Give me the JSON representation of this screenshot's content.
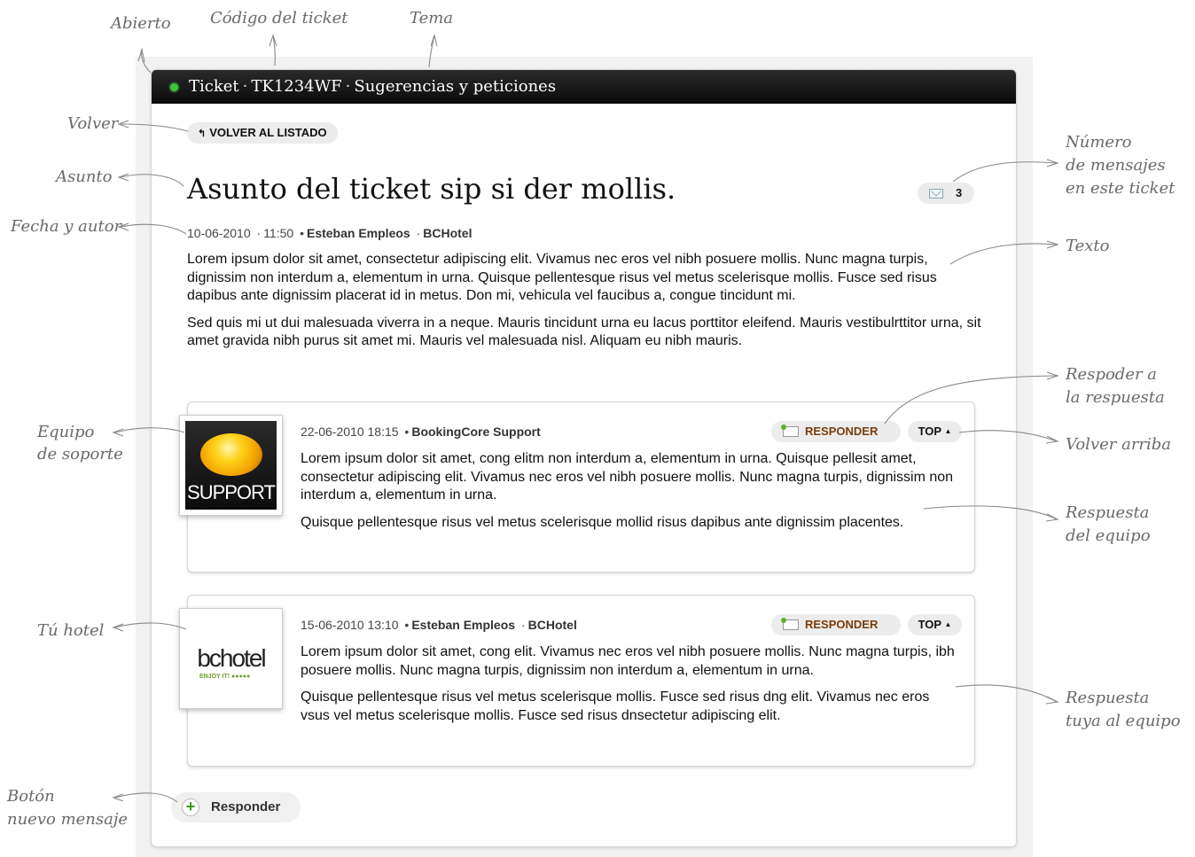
{
  "ticket": {
    "header_label": "Ticket",
    "code": "TK1234WF",
    "topic": "Sugerencias y peticiones",
    "status_color": "#3cc43c",
    "back_button": "VOLVER AL LISTADO",
    "subject": "Asunto del ticket sip si der mollis.",
    "message_count": "3",
    "date": "10-06-2010",
    "time": "11:50",
    "author": "Esteban Empleos",
    "company": "BCHotel",
    "paragraphs": [
      "Lorem ipsum dolor sit amet, consectetur adipiscing elit. Vivamus nec eros vel nibh posuere mollis. Nunc magna turpis, dignissim non interdum a, elementum in urna. Quisque pellentesque risus vel metus scelerisque mollis. Fusce sed risus dapibus ante dignissim placerat id in metus. Don mi, vehicula vel faucibus a, congue tincidunt mi.",
      "Sed quis mi ut dui malesuada viverra in a neque. Mauris tincidunt urna eu lacus porttitor eleifend. Mauris vestibulrttitor urna, sit amet gravida nibh purus sit amet mi. Mauris vel malesuada nisl. Aliquam eu nibh mauris."
    ]
  },
  "replies": [
    {
      "avatar_text": "SUPPORT",
      "datetime": "22-06-2010 18:15",
      "author": "BookingCore Support",
      "company": "",
      "respond_label": "RESPONDER",
      "top_label": "TOP",
      "paragraphs": [
        "Lorem ipsum dolor sit amet, cong elitm non interdum a, elementum in urna. Quisque pellesit amet, consectetur adipiscing elit. Vivamus nec eros vel nibh posuere mollis. Nunc magna turpis, dignissim non interdum a, elementum in urna.",
        "Quisque pellentesque risus vel metus scelerisque mollid risus dapibus ante dignissim placentes."
      ]
    },
    {
      "avatar_text": "bchotel",
      "avatar_tagline": "ENJOY IT!",
      "datetime": "15-06-2010 13:10",
      "author": "Esteban Empleos",
      "company": "BCHotel",
      "respond_label": "RESPONDER",
      "top_label": "TOP",
      "paragraphs": [
        "Lorem ipsum dolor sit amet, cong elit. Vivamus nec eros vel nibh posuere mollis. Nunc magna turpis, ibh posuere mollis. Nunc magna turpis, dignissim non interdum a, elementum in urna.",
        "Quisque pellentesque risus vel metus scelerisque mollis. Fusce sed risus dng elit. Vivamus nec eros vsus vel metus scelerisque mollis. Fusce sed risus dnsectetur adipiscing elit."
      ]
    }
  ],
  "new_message_button": "Responder",
  "annotations": {
    "abierto": "Abierto",
    "codigo": "Código del ticket",
    "tema": "Tema",
    "volver": "Volver",
    "asunto": "Asunto",
    "fecha_autor": "Fecha y autor",
    "numero_1": "Número",
    "numero_2": "de mensajes",
    "numero_3": "en este ticket",
    "texto": "Texto",
    "responder_1": "Respoder a",
    "responder_2": "la respuesta",
    "volver_arriba": "Volver arriba",
    "equipo_1": "Equipo",
    "equipo_2": "de soporte",
    "respuesta_equipo_1": "Respuesta",
    "respuesta_equipo_2": "del equipo",
    "tu_hotel": "Tú hotel",
    "respuesta_tuya_1": "Respuesta",
    "respuesta_tuya_2": "tuya al equipo",
    "boton_1": "Botón",
    "boton_2": "nuevo mensaje"
  }
}
